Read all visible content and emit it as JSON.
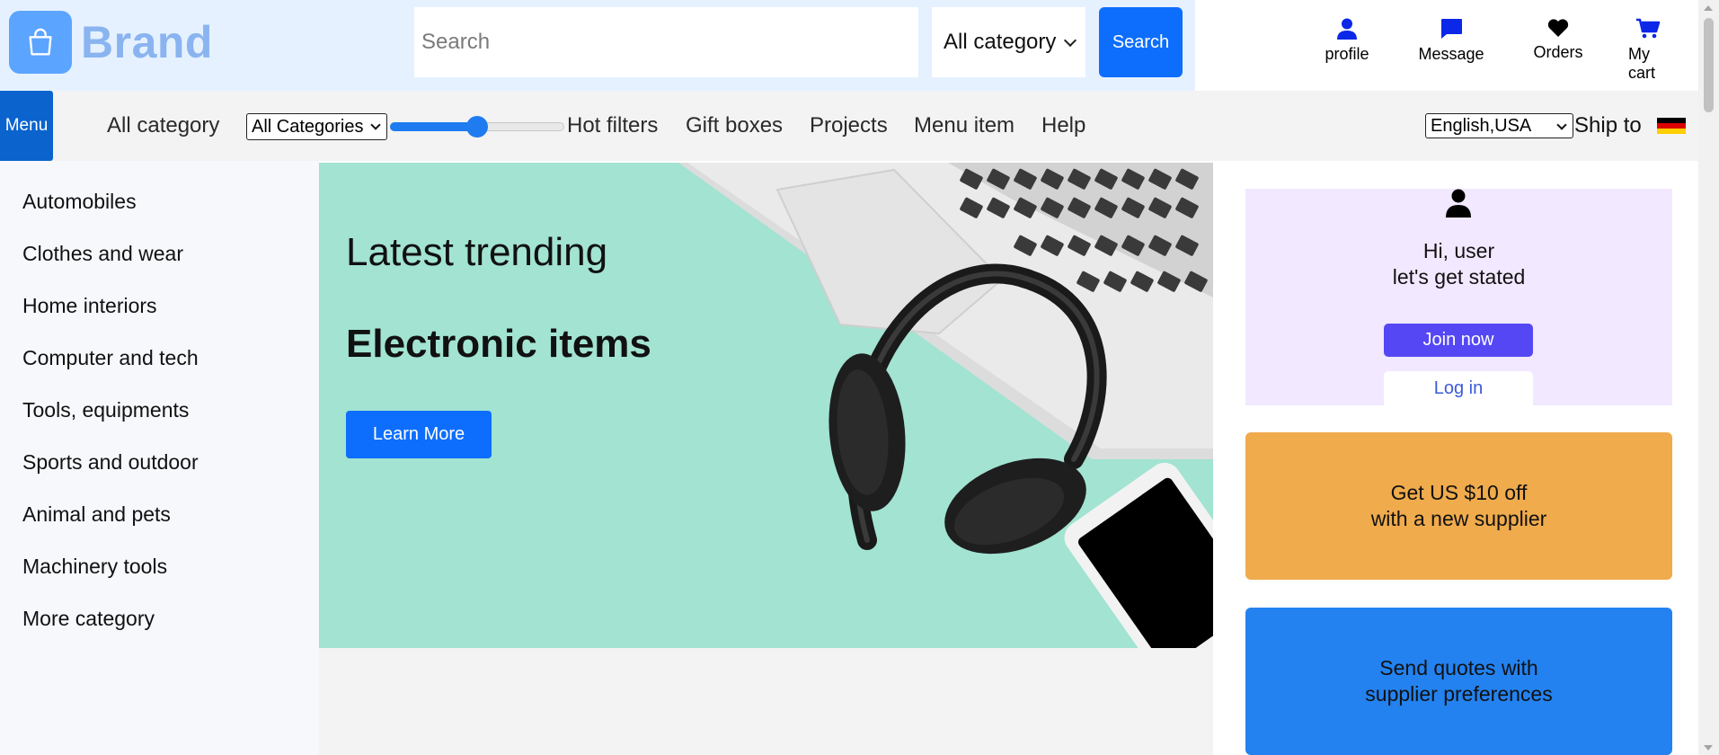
{
  "header": {
    "brand": "Brand",
    "search_placeholder": "Search",
    "category_select": "All category",
    "search_button": "Search",
    "icons": [
      {
        "icon": "profile-icon",
        "label": "profile"
      },
      {
        "icon": "message-icon",
        "label": "Message"
      },
      {
        "icon": "heart-icon",
        "label": "Orders"
      },
      {
        "icon": "cart-icon",
        "label": "My cart"
      }
    ]
  },
  "nav": {
    "menu_button": "Menu",
    "all_category": "All category",
    "categories_select": "All Categories",
    "slider_value_fraction": 0.5,
    "links": [
      "Hot filters",
      "Gift boxes",
      "Projects",
      "Menu item",
      "Help"
    ],
    "language_select": "English,USA",
    "ship_to": "Ship to",
    "flag": "germany-flag"
  },
  "sidebar": {
    "items": [
      "Automobiles",
      "Clothes and wear",
      "Home interiors",
      "Computer and tech",
      "Tools, equipments",
      "Sports and outdoor",
      "Animal and pets",
      "Machinery tools",
      "More category"
    ]
  },
  "hero": {
    "kicker": "Latest trending",
    "title": "Electronic items",
    "button": "Learn More"
  },
  "user_card": {
    "greeting_line1": "Hi, user",
    "greeting_line2": "let's get stated",
    "join_button": "Join now",
    "login_button": "Log in"
  },
  "promos": {
    "orange_line1": "Get US $10 off",
    "orange_line2": "with a new supplier",
    "blue_line1": "Send quotes with",
    "blue_line2": "supplier preferences"
  },
  "colors": {
    "primary": "#0d6efd",
    "menu": "#0b63ce",
    "join": "#5548f4",
    "promo_orange": "#f0ab4c",
    "promo_blue": "#2382f0",
    "hero_bg": "#a2e3d1"
  }
}
